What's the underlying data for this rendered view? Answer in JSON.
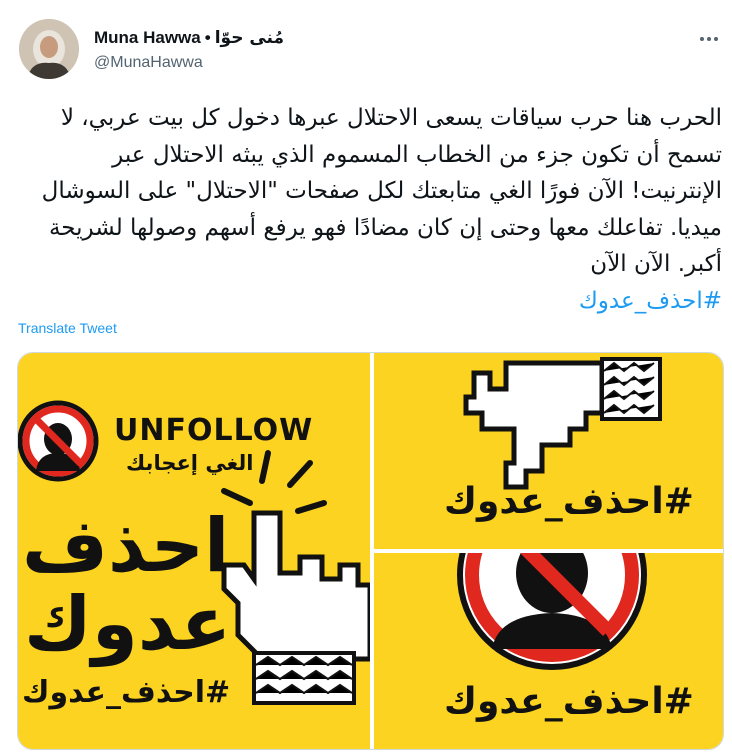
{
  "author": {
    "display_name": "Muna Hawwa",
    "separator": "•",
    "display_name_ar": "مُنى حوّا",
    "handle": "@MunaHawwa"
  },
  "tweet": {
    "text": "الحرب هنا حرب سياقات يسعى الاحتلال عبرها دخول كل بيت عربي، لا تسمح أن تكون جزء من الخطاب المسموم الذي يبثه الاحتلال عبر الإنترنيت! الآن فورًا الغي متابعتك لكل صفحات \"الاحتلال\" على السوشال ميديا. تفاعلك معها وحتى إن كان مضادًا فهو يرفع أسهم وصولها لشريحة أكبر. الآن الآن",
    "hashtag": "#احذف_عدوك",
    "translate_label": "Translate Tweet"
  },
  "media": {
    "left_panel": {
      "unfollow_text": "UNFOLLOW",
      "subtitle": "الغي إعجابك",
      "big_line1": "احذف",
      "big_line2": "عدوك",
      "hashtag": "#احذف_عدوك"
    },
    "top_right_panel": {
      "hashtag": "#احذف_عدوك"
    },
    "bottom_right_panel": {
      "hashtag": "#احذف_عدوك"
    }
  },
  "colors": {
    "panel_yellow": "#fcd321",
    "link_blue": "#1d9bf0",
    "prohibit_red": "#e0281e"
  }
}
